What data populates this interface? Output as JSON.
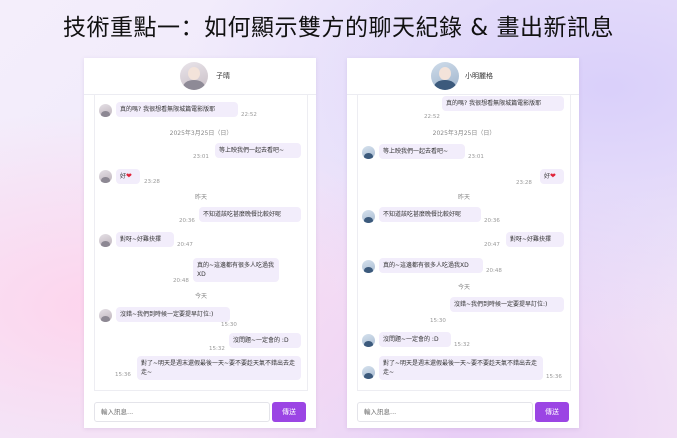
{
  "headline": "技術重點一：如何顯示雙方的聊天紀錄 & 畫出新訊息",
  "colors": {
    "accent": "#9b45e4",
    "bubble": "#f2edfb",
    "heart": "#e0243a"
  },
  "left_panel": {
    "contact_name": "子晴",
    "messages": {
      "m1": {
        "text": "真的嗎? 我很想看無限城篇電影版耶",
        "time": "22:52"
      },
      "sep1": "2025年3月25日（日）",
      "m2": {
        "text": "等上映我們一起去看吧~",
        "time": "23:01"
      },
      "m3": {
        "text": "好",
        "time": "23:28"
      },
      "sep2": "昨天",
      "m4": {
        "text": "不知道該吃甚麼晚餐比較好呢",
        "time": "20:36"
      },
      "m5": {
        "text": "對呀~好難抉擇",
        "time": "20:47"
      },
      "m6": {
        "text": "真的~這邊都有很多人吃過我XD",
        "time": "20:48"
      },
      "sep3": "今天",
      "m7": {
        "text": "沒錯~我們到時候一定要提早訂位:)",
        "time": "15:30"
      },
      "m8": {
        "text": "沒問題~一定會的 :D",
        "time": "15:32"
      },
      "m9": {
        "text": "對了~明天是週末還假最後一天~要不要趁天氣不錯出去走走~",
        "time": "15:36"
      }
    },
    "input_placeholder": "輸入訊息...",
    "send_label": "傳送"
  },
  "right_panel": {
    "contact_name": "小明麗格",
    "messages": {
      "m1": {
        "text": "真的嗎? 我很想看無限城篇電影版耶",
        "time": "22:52"
      },
      "sep1": "2025年3月25日（日）",
      "m2": {
        "text": "等上映我們一起去看吧~",
        "time": "23:01"
      },
      "m3": {
        "text": "好",
        "time": "23:28"
      },
      "sep2": "昨天",
      "m4": {
        "text": "不知道該吃甚麼晚餐比較好呢",
        "time": "20:36"
      },
      "m5": {
        "text": "對呀~好難抉擇",
        "time": "20:47"
      },
      "m6": {
        "text": "真的~這邊都有很多人吃過我XD",
        "time": "20:48"
      },
      "sep3": "今天",
      "m7": {
        "text": "沒錯~我們到時候一定要提早訂位:)",
        "time": "15:30"
      },
      "m8": {
        "text": "沒問題~一定會的 :D",
        "time": "15:32"
      },
      "m9": {
        "text": "對了~明天是週末還假最後一天~要不要趁天氣不錯出去走走~",
        "time": "15:36"
      }
    },
    "input_placeholder": "輸入訊息...",
    "send_label": "傳送"
  }
}
